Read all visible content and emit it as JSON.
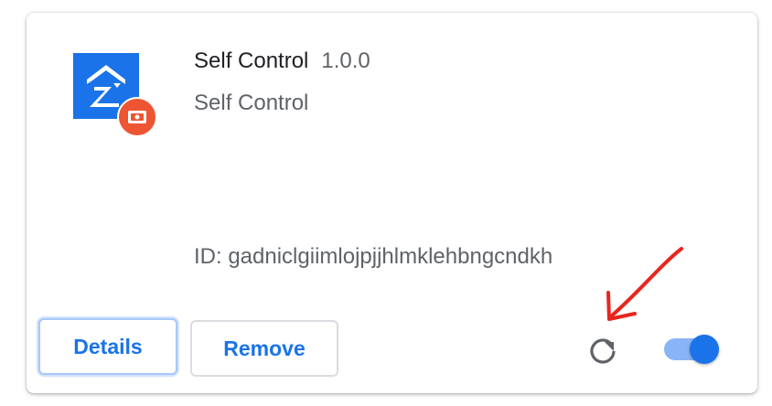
{
  "extension": {
    "name": "Self Control",
    "version": "1.0.0",
    "description": "Self Control",
    "id_text": "ID: gadniclgiimlojpjjhlmklehbngcndkh",
    "icon": "extension-logo-icon",
    "badge_icon": "unpacked-extension-badge-icon"
  },
  "actions": {
    "details_label": "Details",
    "remove_label": "Remove",
    "reload_icon": "reload-icon",
    "toggle_state": "on"
  },
  "colors": {
    "accent": "#1a73e8",
    "toggle_track": "#8ab4f8",
    "badge": "#ee5533",
    "annotation_arrow": "#e8261e"
  }
}
